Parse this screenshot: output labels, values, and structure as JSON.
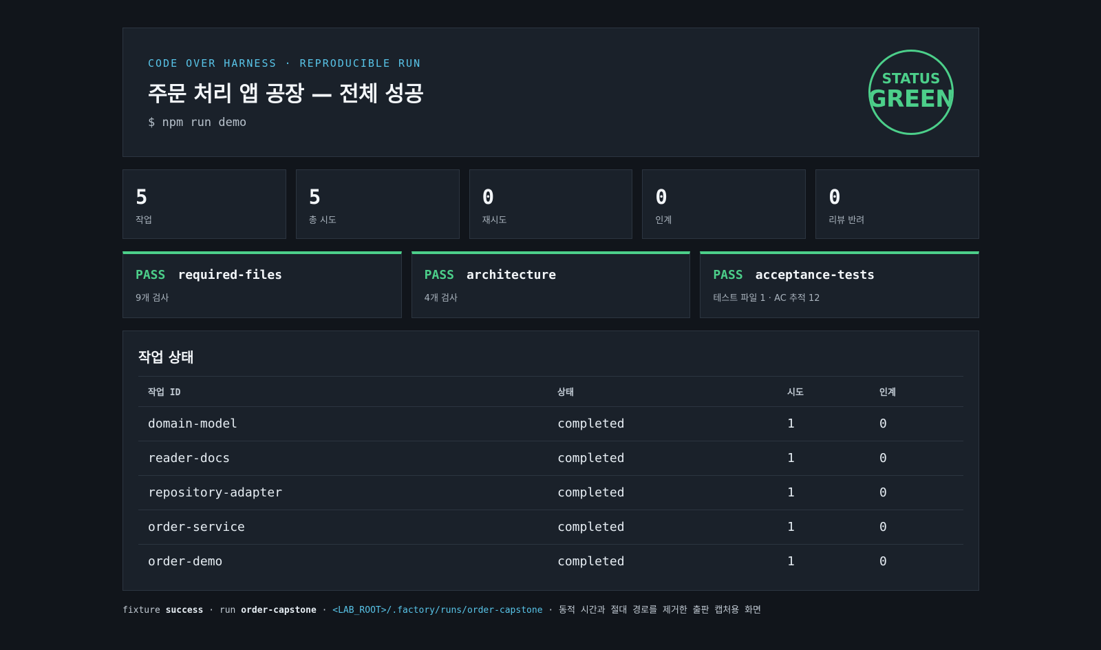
{
  "header": {
    "eyebrow": "CODE OVER HARNESS · REPRODUCIBLE RUN",
    "title": "주문 처리 앱 공장 — 전체 성공",
    "command": "$ npm run demo",
    "status_label": "STATUS",
    "status_value": "GREEN"
  },
  "stats": [
    {
      "value": "5",
      "label": "작업"
    },
    {
      "value": "5",
      "label": "총 시도"
    },
    {
      "value": "0",
      "label": "재시도"
    },
    {
      "value": "0",
      "label": "인계"
    },
    {
      "value": "0",
      "label": "리뷰 반려"
    }
  ],
  "checks": [
    {
      "status": "PASS",
      "name": "required-files",
      "detail": "9개 검사"
    },
    {
      "status": "PASS",
      "name": "architecture",
      "detail": "4개 검사"
    },
    {
      "status": "PASS",
      "name": "acceptance-tests",
      "detail": "테스트 파일 1 · AC 추적 12"
    }
  ],
  "tasks": {
    "title": "작업 상태",
    "columns": [
      "작업 ID",
      "상태",
      "시도",
      "인계"
    ],
    "rows": [
      [
        "domain-model",
        "completed",
        "1",
        "0"
      ],
      [
        "reader-docs",
        "completed",
        "1",
        "0"
      ],
      [
        "repository-adapter",
        "completed",
        "1",
        "0"
      ],
      [
        "order-service",
        "completed",
        "1",
        "0"
      ],
      [
        "order-demo",
        "completed",
        "1",
        "0"
      ]
    ]
  },
  "footer": {
    "fixture_label": "fixture",
    "fixture_value": "success",
    "sep1": " · ",
    "run_label": "run",
    "run_value": "order-capstone",
    "sep2": " · ",
    "path": "<LAB_ROOT>/.factory/runs/order-capstone",
    "sep3": " · ",
    "note": "동적 시간과 절대 경로를 제거한 출판 캡처용 화면"
  },
  "colors": {
    "background": "#11151b",
    "panel": "#1a212a",
    "border": "#2c3540",
    "accent_green": "#4ccf8a",
    "accent_blue": "#58c4e8"
  }
}
